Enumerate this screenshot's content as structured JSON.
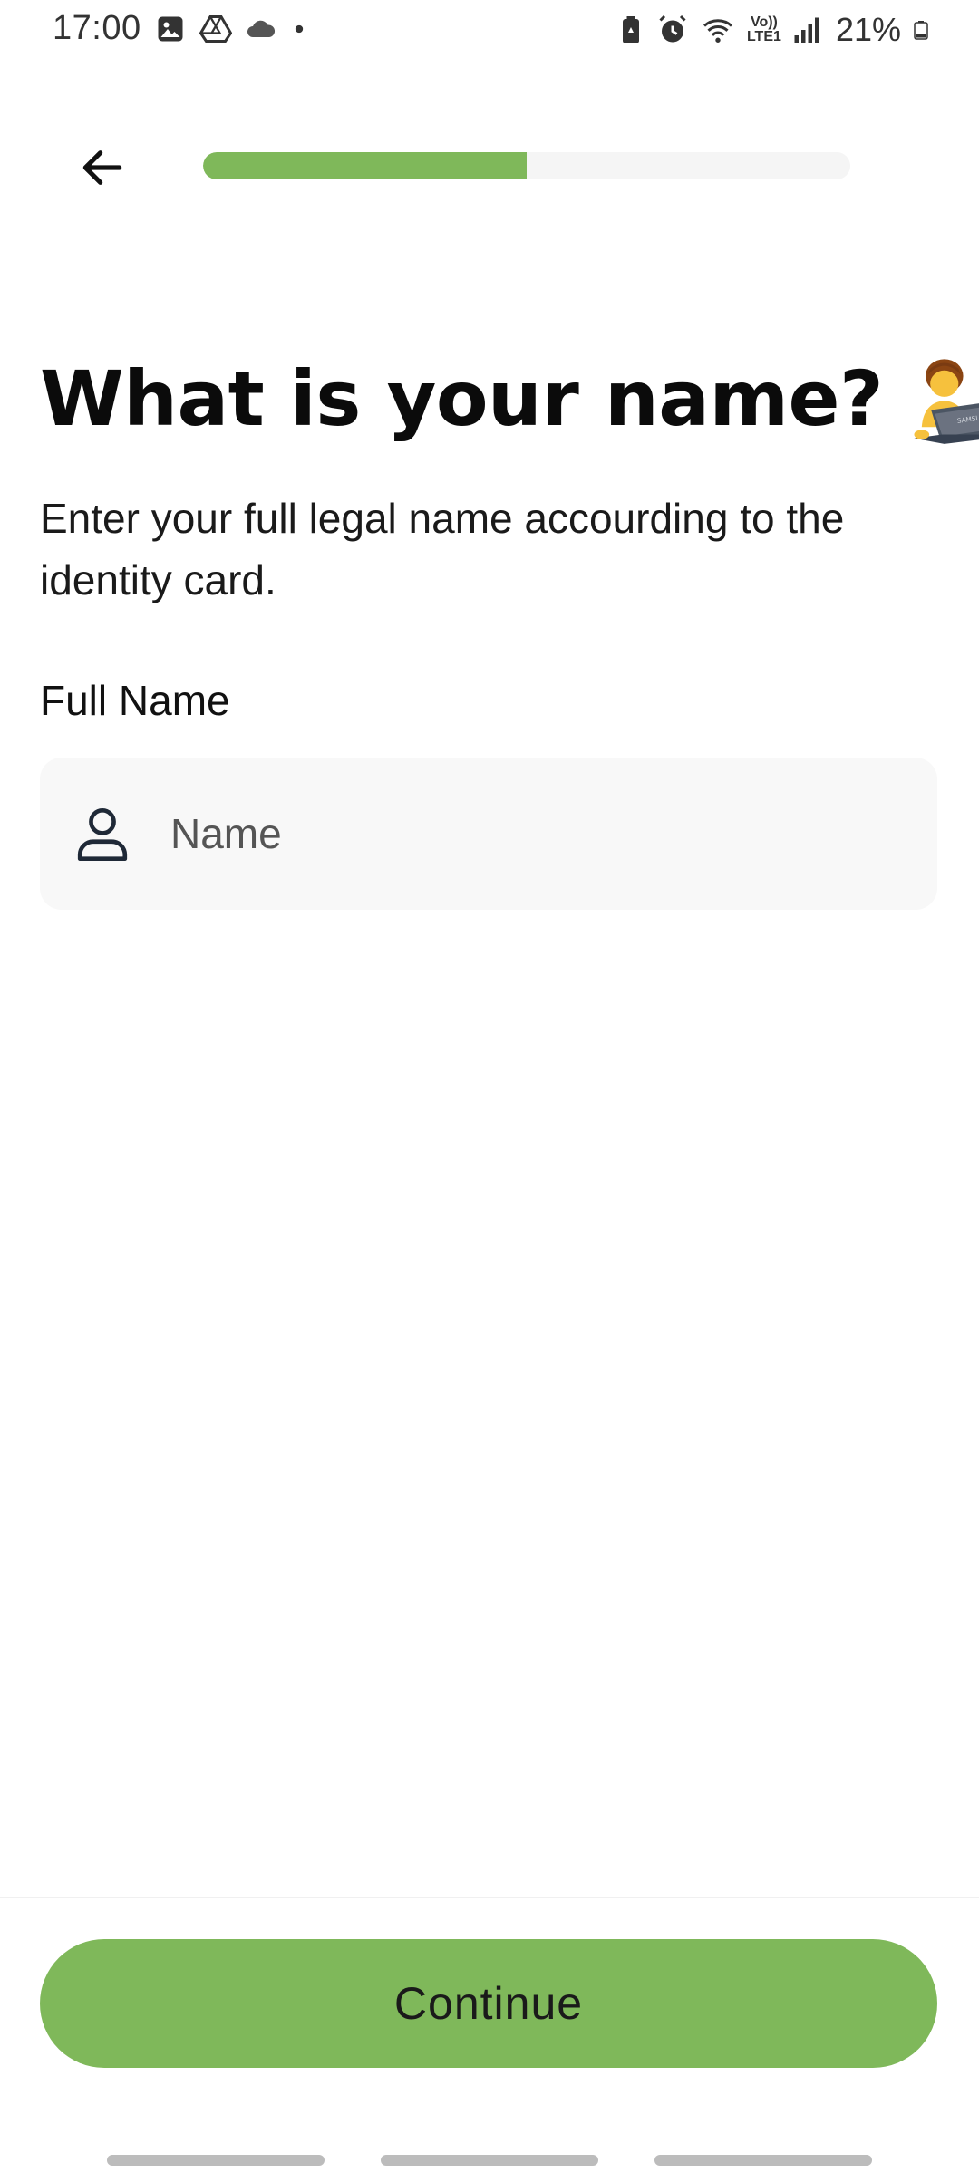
{
  "status_bar": {
    "time": "17:00",
    "battery_percent": "21%",
    "left_icons": [
      "gallery-icon",
      "drive-icon",
      "cloud-icon",
      "dot-icon"
    ],
    "right_icons": [
      "battery-saver-icon",
      "alarm-icon",
      "wifi-icon",
      "volte-icon",
      "signal-icon",
      "battery-icon"
    ],
    "volte_label": "Vo)) LTE1"
  },
  "header": {
    "back_icon": "arrow-left-icon",
    "progress_fraction": 0.5
  },
  "main": {
    "title": "What is your name?",
    "title_emoji": "person-at-laptop-emoji",
    "laptop_brand": "SAMSUNG",
    "subtitle": "Enter your full legal name accourding to the identity card.",
    "field_label": "Full Name",
    "name_input": {
      "placeholder": "Name",
      "value": "",
      "icon": "user-icon"
    }
  },
  "footer": {
    "continue_label": "Continue"
  },
  "colors": {
    "accent": "#7fb85a",
    "input_bg": "#f8f8f8",
    "track_bg": "#f5f5f5"
  }
}
